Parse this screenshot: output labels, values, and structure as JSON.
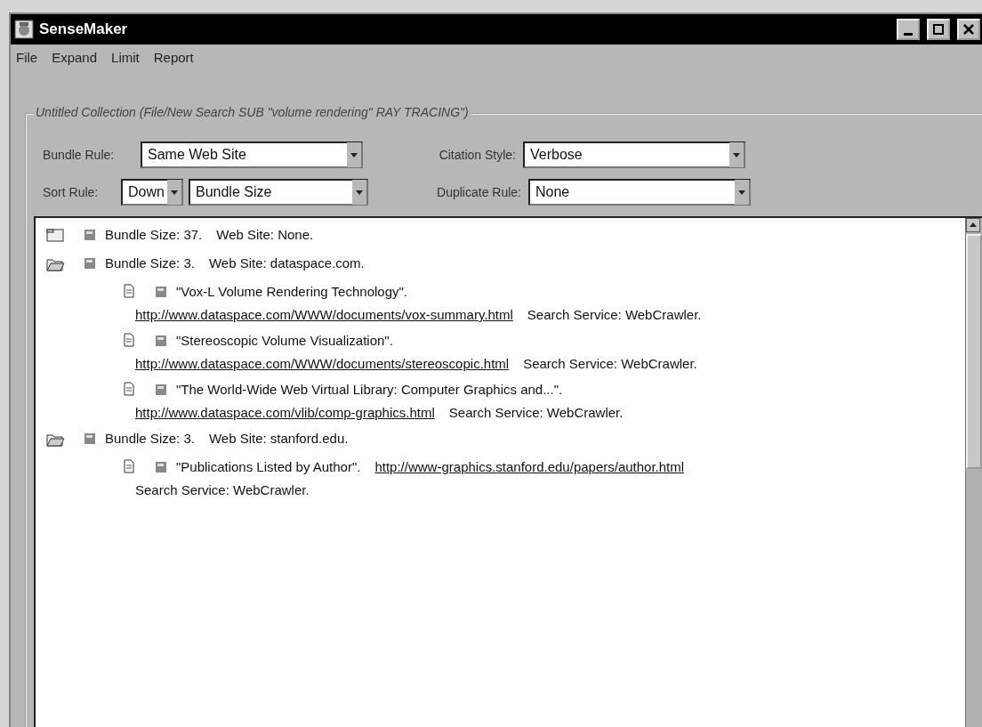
{
  "window": {
    "title": "SenseMaker"
  },
  "menu": [
    "File",
    "Expand",
    "Limit",
    "Report"
  ],
  "collection": {
    "title": "Untitled Collection (File/New Search SUB \"volume rendering\" RAY TRACING\")",
    "bundle_rule": {
      "label": "Bundle Rule:",
      "value": "Same Web Site"
    },
    "citation_style": {
      "label": "Citation Style:",
      "value": "Verbose"
    },
    "sort_rule": {
      "label": "Sort Rule:",
      "direction": "Down",
      "value": "Bundle Size"
    },
    "duplicate_rule": {
      "label": "Duplicate Rule:",
      "value": "None"
    },
    "bundles": [
      {
        "expanded": false,
        "lines": [
          [
            {
              "kind": "text",
              "text": "Bundle Size: 37."
            },
            {
              "kind": "text",
              "text": "Web Site: None."
            }
          ]
        ]
      },
      {
        "expanded": true,
        "lines": [
          [
            {
              "kind": "text",
              "text": "Bundle Size: 3."
            },
            {
              "kind": "text",
              "text": "Web Site: dataspace.com."
            }
          ]
        ],
        "children": [
          {
            "lines": [
              [
                {
                  "kind": "text",
                  "text": "\"Vox-L Volume Rendering Technology\"."
                }
              ],
              [
                {
                  "kind": "link",
                  "text": "http://www.dataspace.com/WWW/documents/vox-summary.html"
                },
                {
                  "kind": "text",
                  "text": "Search Service: WebCrawler."
                }
              ]
            ]
          },
          {
            "lines": [
              [
                {
                  "kind": "text",
                  "text": "\"Stereoscopic Volume Visualization\"."
                }
              ],
              [
                {
                  "kind": "link",
                  "text": "http://www.dataspace.com/WWW/documents/stereoscopic.html"
                },
                {
                  "kind": "text",
                  "text": "Search Service: WebCrawler."
                }
              ]
            ]
          },
          {
            "lines": [
              [
                {
                  "kind": "text",
                  "text": "\"The World-Wide Web Virtual Library: Computer Graphics and...\"."
                }
              ],
              [
                {
                  "kind": "link",
                  "text": "http://www.dataspace.com/vlib/comp-graphics.html"
                },
                {
                  "kind": "text",
                  "text": "Search Service: WebCrawler."
                }
              ]
            ]
          }
        ]
      },
      {
        "expanded": true,
        "lines": [
          [
            {
              "kind": "text",
              "text": "Bundle Size: 3."
            },
            {
              "kind": "text",
              "text": "Web Site: stanford.edu."
            }
          ]
        ],
        "children": [
          {
            "lines": [
              [
                {
                  "kind": "text",
                  "text": "\"Publications Listed by Author\"."
                },
                {
                  "kind": "link",
                  "text": "http://www-graphics.stanford.edu/papers/author.html"
                }
              ],
              [
                {
                  "kind": "text",
                  "text": "Search Service: WebCrawler."
                }
              ]
            ]
          }
        ]
      }
    ]
  }
}
